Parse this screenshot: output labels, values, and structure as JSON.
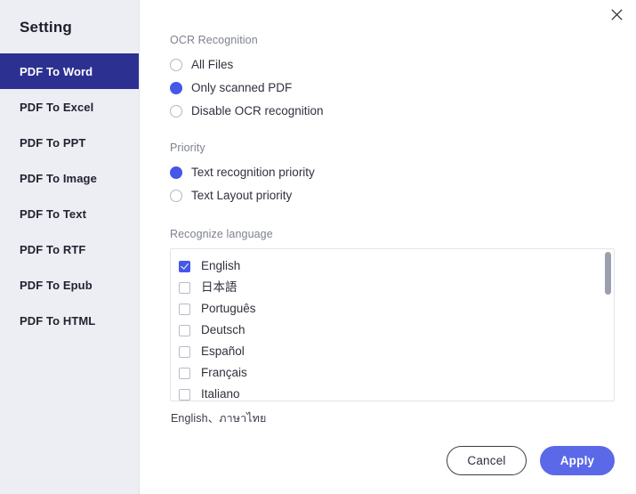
{
  "sidebar": {
    "title": "Setting",
    "items": [
      {
        "label": "PDF To Word",
        "active": true
      },
      {
        "label": "PDF To Excel",
        "active": false
      },
      {
        "label": "PDF To PPT",
        "active": false
      },
      {
        "label": "PDF To Image",
        "active": false
      },
      {
        "label": "PDF To Text",
        "active": false
      },
      {
        "label": "PDF To RTF",
        "active": false
      },
      {
        "label": "PDF To Epub",
        "active": false
      },
      {
        "label": "PDF To HTML",
        "active": false
      }
    ]
  },
  "titlebar": {
    "close_icon": "close-icon"
  },
  "ocr_section": {
    "label": "OCR Recognition",
    "options": [
      {
        "label": "All Files",
        "selected": false
      },
      {
        "label": "Only scanned PDF",
        "selected": true
      },
      {
        "label": "Disable OCR recognition",
        "selected": false
      }
    ]
  },
  "priority_section": {
    "label": "Priority",
    "options": [
      {
        "label": "Text recognition priority",
        "selected": true
      },
      {
        "label": "Text Layout priority",
        "selected": false
      }
    ]
  },
  "language_section": {
    "label": "Recognize language",
    "languages": [
      {
        "label": "English",
        "checked": true
      },
      {
        "label": "日本語",
        "checked": false
      },
      {
        "label": "Português",
        "checked": false
      },
      {
        "label": "Deutsch",
        "checked": false
      },
      {
        "label": "Español",
        "checked": false
      },
      {
        "label": "Français",
        "checked": false
      },
      {
        "label": "Italiano",
        "checked": false
      }
    ],
    "selected_summary": "English、ภาษาไทย"
  },
  "footer": {
    "cancel_label": "Cancel",
    "apply_label": "Apply"
  },
  "colors": {
    "sidebar_bg": "#edeef3",
    "sidebar_active_bg": "#2c3191",
    "accent_control": "#4558e8",
    "apply_button": "#5b68e8",
    "section_label": "#7e8290",
    "scrollbar_thumb": "#9b9fae"
  }
}
